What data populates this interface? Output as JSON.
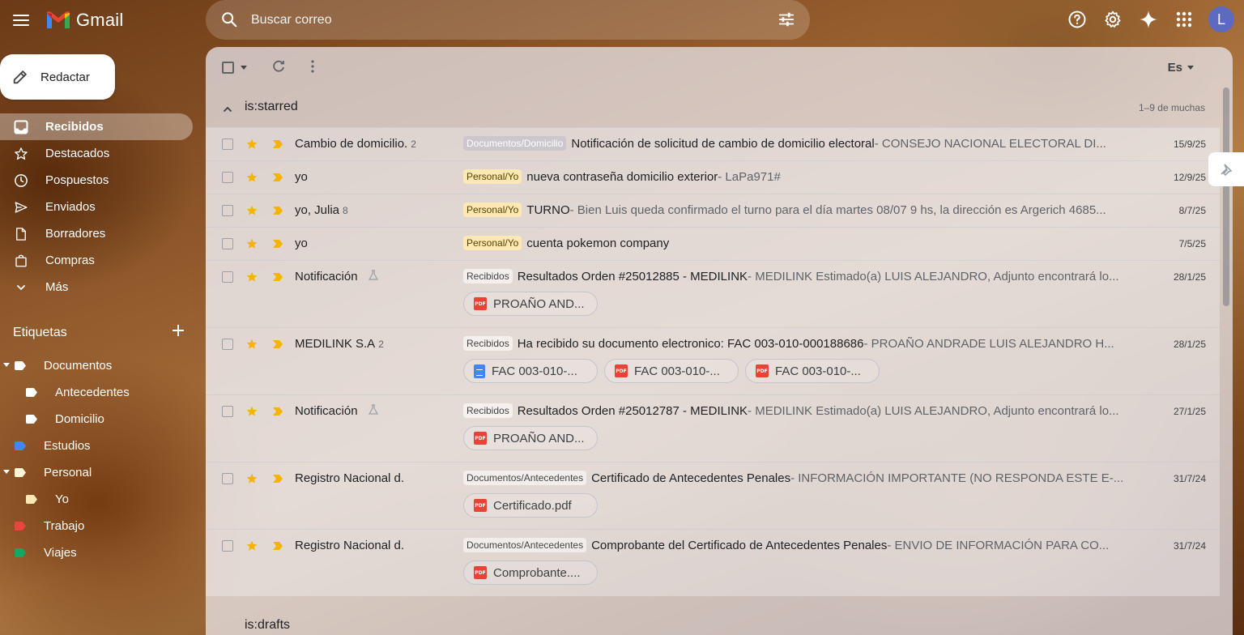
{
  "app": {
    "name": "Gmail"
  },
  "search": {
    "placeholder": "Buscar correo"
  },
  "compose": {
    "label": "Redactar"
  },
  "sidebar": {
    "items": [
      {
        "label": "Recibidos",
        "icon": "inbox-icon",
        "active": true
      },
      {
        "label": "Destacados",
        "icon": "star-icon"
      },
      {
        "label": "Pospuestos",
        "icon": "clock-icon"
      },
      {
        "label": "Enviados",
        "icon": "send-icon"
      },
      {
        "label": "Borradores",
        "icon": "draft-icon"
      },
      {
        "label": "Compras",
        "icon": "shopping-bag-icon"
      },
      {
        "label": "Más",
        "icon": "chevron-down-icon"
      }
    ],
    "labels_title": "Etiquetas",
    "labels": [
      {
        "label": "Documentos",
        "color": "#ffffff",
        "expanded": true
      },
      {
        "label": "Antecedentes",
        "color": "#ffffff"
      },
      {
        "label": "Domicilio",
        "color": "#ffffff"
      },
      {
        "label": "Estudios",
        "color": "#4285f4"
      },
      {
        "label": "Personal",
        "color": "#fdf3d6",
        "expanded": true
      },
      {
        "label": "Yo",
        "color": "#fce8b2"
      },
      {
        "label": "Trabajo",
        "color": "#e8453c"
      },
      {
        "label": "Viajes",
        "color": "#16a765"
      }
    ]
  },
  "toolbar": {
    "language": "Es"
  },
  "section1": {
    "title": "is:starred",
    "count": "1–9 de muchas"
  },
  "section2": {
    "title": "is:drafts"
  },
  "emails": [
    {
      "sender": "Cambio de domicilio.",
      "count": "2",
      "tag": "Documentos/Domicilio",
      "subject": "Notificación de solicitud de cambio de domicilio electoral",
      "snippet": " - CONSEJO NACIONAL ELECTORAL DI...",
      "date": "15/9/25"
    },
    {
      "sender": "yo",
      "count": "",
      "tag": "Personal/Yo",
      "subject": "nueva contraseña domicilio exterior",
      "snippet": " - LaPa971#",
      "date": "12/9/25"
    },
    {
      "sender": "yo, Julia",
      "count": "8",
      "tag": "Personal/Yo",
      "subject": "TURNO",
      "snippet": " - Bien Luis queda confirmado el turno para el día martes 08/07 9 hs, la dirección es Argerich 4685...",
      "date": "8/7/25"
    },
    {
      "sender": "yo",
      "count": "",
      "tag": "Personal/Yo",
      "subject": "cuenta pokemon company",
      "snippet": "",
      "date": "7/5/25"
    },
    {
      "sender": "Notificación",
      "count": "",
      "tag": "Recibidos",
      "subject": "Resultados Orden #25012885 - MEDILINK",
      "snippet": " - MEDILINK Estimado(a) LUIS ALEJANDRO, Adjunto encontrará lo...",
      "date": "28/1/25",
      "attachments": [
        "PROAÑO AND..."
      ]
    },
    {
      "sender": "MEDILINK S.A",
      "count": "2",
      "tag": "Recibidos",
      "subject": "Ha recibido su documento electronico: FAC 003-010-000188686",
      "snippet": " - PROAÑO ANDRADE LUIS ALEJANDRO H...",
      "date": "28/1/25",
      "attachments": [
        "FAC 003-010-...",
        "FAC 003-010-...",
        "FAC 003-010-..."
      ]
    },
    {
      "sender": "Notificación",
      "count": "",
      "tag": "Recibidos",
      "subject": "Resultados Orden #25012787 - MEDILINK",
      "snippet": " - MEDILINK Estimado(a) LUIS ALEJANDRO, Adjunto encontrará lo...",
      "date": "27/1/25",
      "attachments": [
        "PROAÑO AND..."
      ]
    },
    {
      "sender": "Registro Nacional d.",
      "count": "",
      "tag": "Documentos/Antecedentes",
      "subject": "Certificado de Antecedentes Penales",
      "snippet": " - INFORMACIÓN IMPORTANTE (NO RESPONDA ESTE E-...",
      "date": "31/7/24",
      "attachments": [
        "Certificado.pdf"
      ]
    },
    {
      "sender": "Registro Nacional d.",
      "count": "",
      "tag": "Documentos/Antecedentes",
      "subject": "Comprobante del Certificado de Antecedentes Penales",
      "snippet": " - ENVIO DE INFORMACIÓN PARA CO...",
      "date": "31/7/24",
      "attachments": [
        "Comprobante...."
      ]
    }
  ],
  "avatar": {
    "initial": "L"
  }
}
